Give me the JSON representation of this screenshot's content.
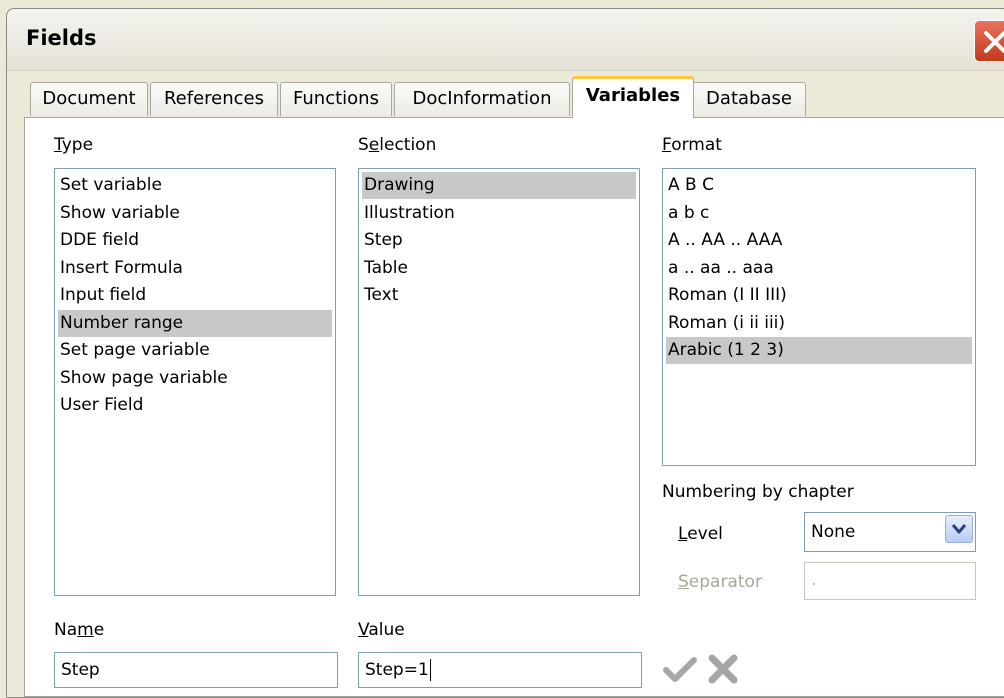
{
  "window": {
    "title": "Fields"
  },
  "tabs": [
    "Document",
    "References",
    "Functions",
    "DocInformation",
    "Variables",
    "Database"
  ],
  "type": {
    "label_u": "T",
    "label_rest": "ype",
    "items": [
      "Set variable",
      "Show variable",
      "DDE field",
      "Insert Formula",
      "Input field",
      "Number range",
      "Set page variable",
      "Show page variable",
      "User Field"
    ],
    "selected_index": 5
  },
  "selection": {
    "label_a": "S",
    "label_u": "e",
    "label_rest": "lection",
    "items": [
      "Drawing",
      "Illustration",
      "Step",
      "Table",
      "Text"
    ],
    "selected_index": 0
  },
  "format": {
    "label_u": "F",
    "label_rest": "ormat",
    "items": [
      "A B C",
      "a b c",
      "A .. AA .. AAA",
      "a .. aa .. aaa",
      "Roman (I II III)",
      "Roman (i ii iii)",
      "Arabic (1 2 3)"
    ],
    "selected_index": 6
  },
  "numbering": {
    "heading": "Numbering by chapter",
    "level_u": "L",
    "level_rest": "evel",
    "level_value": "None",
    "separator_u": "S",
    "separator_rest": "eparator",
    "separator_value": "."
  },
  "name": {
    "label_a": "Na",
    "label_u": "m",
    "label_rest": "e",
    "value": "Step"
  },
  "value": {
    "label_u": "V",
    "label_rest": "alue",
    "value": "Step=1"
  },
  "icons": {
    "apply": "checkmark-icon",
    "delete": "delete-x-icon",
    "close": "close-icon"
  }
}
